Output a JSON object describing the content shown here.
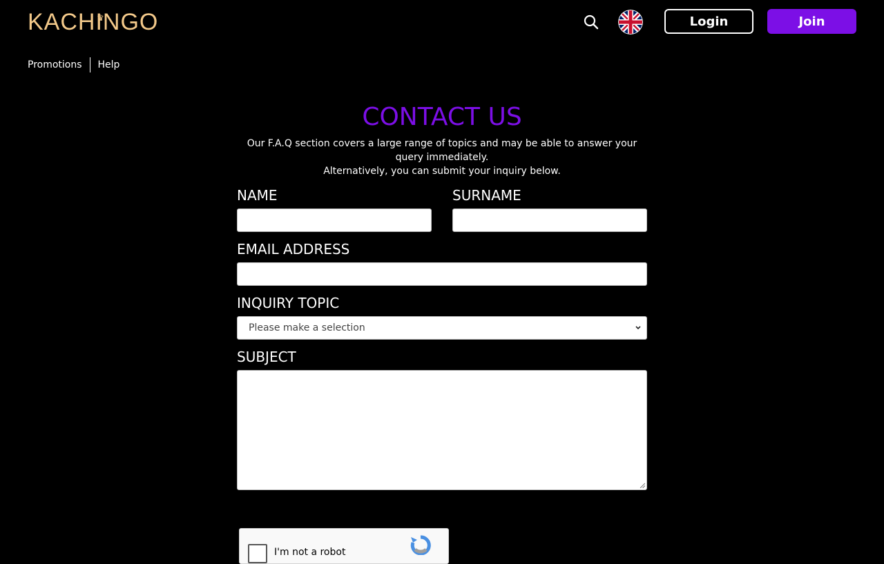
{
  "brand": {
    "name": "KACHINGO"
  },
  "header": {
    "search_icon": "search-icon",
    "language_flag": "uk-flag-icon",
    "login_label": "Login",
    "join_label": "Join"
  },
  "nav": {
    "items": [
      {
        "label": "Promotions"
      },
      {
        "label": "Help"
      }
    ]
  },
  "contact": {
    "title": "CONTACT US",
    "intro_line1": "Our F.A.Q section covers a large range of topics and may be able to answer your query immediately.",
    "intro_line2": "Alternatively, you can submit your inquiry below.",
    "fields": {
      "name_label": "NAME",
      "name_value": "",
      "surname_label": "SURNAME",
      "surname_value": "",
      "email_label": "EMAIL ADDRESS",
      "email_value": "",
      "topic_label": "INQUIRY TOPIC",
      "topic_selected": "Please make a selection",
      "subject_label": "SUBJECT",
      "subject_value": ""
    },
    "captcha": {
      "label": "I'm not a robot"
    }
  },
  "colors": {
    "background": "#000000",
    "accent": "#7c0fe6",
    "brand_gold": "#f3c98a"
  }
}
